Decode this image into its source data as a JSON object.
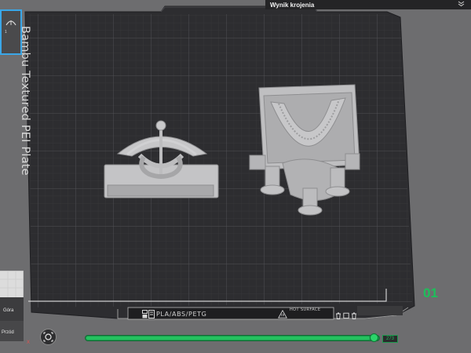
{
  "window": {
    "panel_title": "Wynik krojenia"
  },
  "plate": {
    "name": "Bambu Textured PEI Plate",
    "number": "01",
    "filament_types": "PLA/ABS/PETG",
    "hot_surface_label": "HOT SURFACE"
  },
  "thumbnail": {
    "index": "1"
  },
  "view_cube": {
    "top_label": "Góra",
    "front_label": "Przód",
    "axis_x": "X"
  },
  "slider": {
    "layer_value": "273",
    "progress": 0.97
  },
  "colors": {
    "accent_green": "#1dbf5a",
    "selection_blue": "#3aa7e8",
    "panel_dark": "#242426"
  },
  "icons": {
    "collapse": "chevron-double-down-icon",
    "focus": "focus-target-icon",
    "filament": "filament-badge-icon",
    "hot_surface": "hot-surface-warning-icon"
  }
}
